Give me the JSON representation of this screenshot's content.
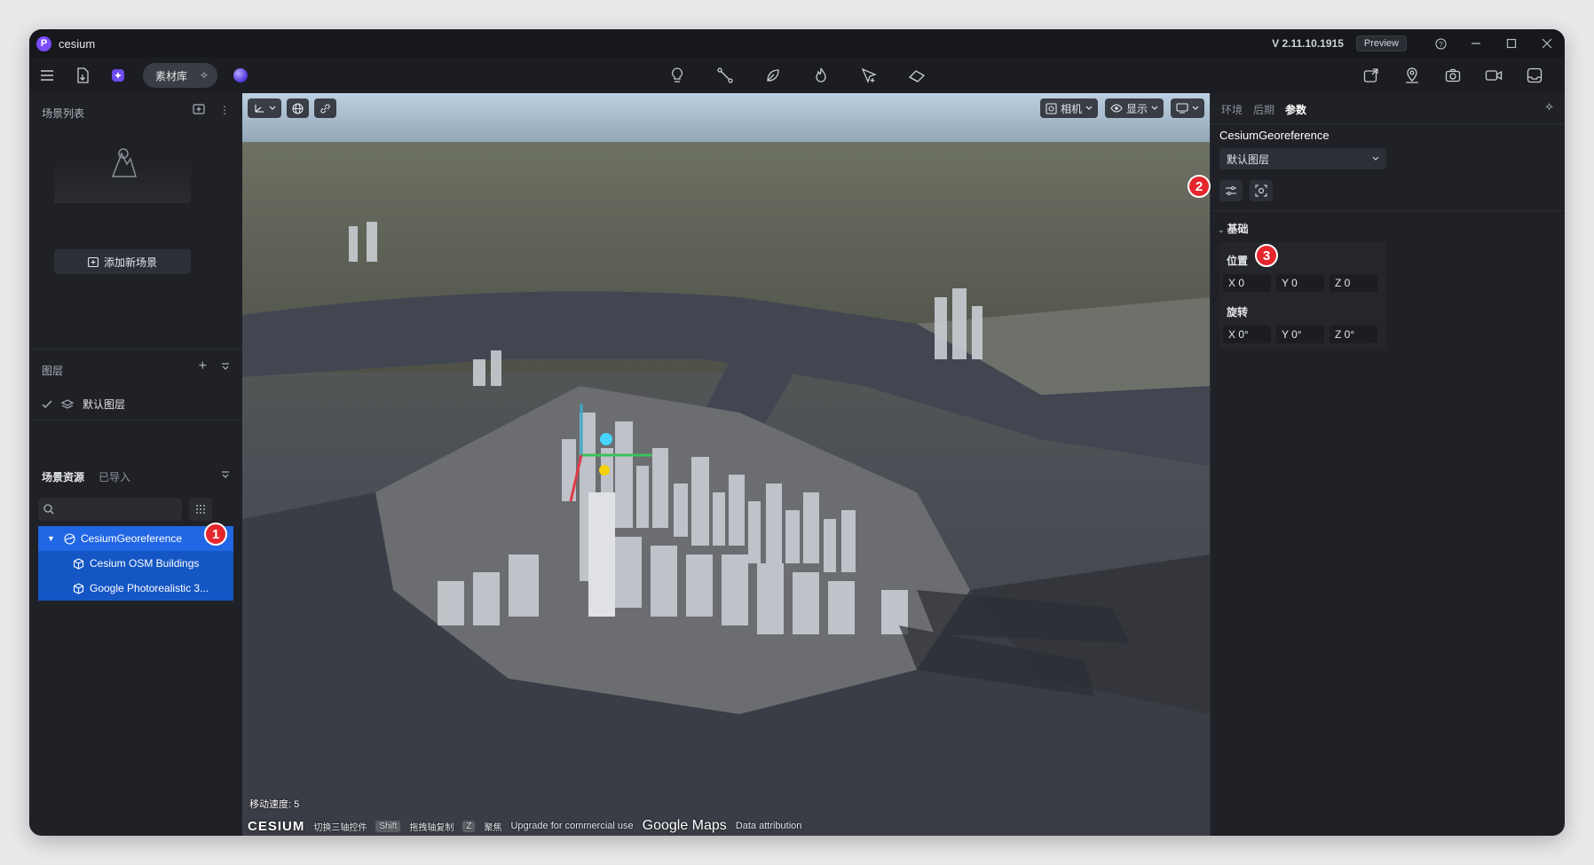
{
  "app": {
    "title": "cesium",
    "logo_letter": "P",
    "version": "V 2.11.10.1915",
    "preview_label": "Preview"
  },
  "toolbar": {
    "assets_label": "素材库"
  },
  "left_panel": {
    "scene_list_title": "场景列表",
    "add_scene_label": "添加新场景",
    "layers_title": "图层",
    "default_layer": "默认图层",
    "tabs": {
      "resources": "场景资源",
      "imported": "已导入"
    },
    "search_placeholder": "",
    "tree": [
      {
        "label": "CesiumGeoreference",
        "badge": "1"
      },
      {
        "label": "Cesium OSM Buildings"
      },
      {
        "label": "Google Photorealistic 3..."
      }
    ]
  },
  "viewport": {
    "camera_label": "相机",
    "display_label": "显示",
    "speed_text": "移动速度: 5",
    "bottom": {
      "cesium_logo": "CESIUM",
      "toggle_gizmo": "切换三轴控件",
      "key_shift": "Shift",
      "drag_copy": "拖拽轴复制",
      "key_z": "Z",
      "focus": "聚焦",
      "google_logo": "Google Maps",
      "upgrade": "Upgrade for commercial use",
      "attribution": "Data attribution"
    }
  },
  "right_panel": {
    "tabs": [
      "环境",
      "后期",
      "参数"
    ],
    "active_tab": "参数",
    "title": "CesiumGeoreference",
    "layer_select": "默认图层",
    "badge2": "2",
    "badge3": "3",
    "basic_label": "基础",
    "position_label": "位置",
    "position": {
      "x": "X 0",
      "y": "Y 0",
      "z": "Z 0"
    },
    "rotation_label": "旋转",
    "rotation": {
      "x": "X 0°",
      "y": "Y 0°",
      "z": "Z 0°"
    }
  }
}
